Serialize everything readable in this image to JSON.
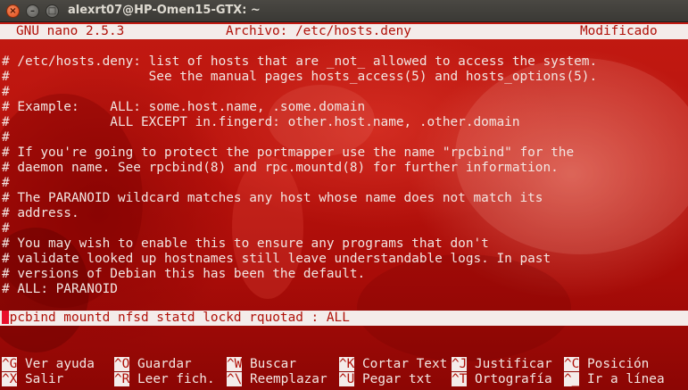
{
  "window": {
    "title": "alexrt07@HP-Omen15-GTX: ~",
    "close_glyph": "×",
    "min_glyph": "–",
    "max_glyph": "□"
  },
  "nano": {
    "version": "GNU nano 2.5.3",
    "file": "Archivo: /etc/hosts.deny",
    "status": "Modificado"
  },
  "content": [
    "# /etc/hosts.deny: list of hosts that are _not_ allowed to access the system.",
    "#                  See the manual pages hosts_access(5) and hosts_options(5).",
    "#",
    "# Example:    ALL: some.host.name, .some.domain",
    "#             ALL EXCEPT in.fingerd: other.host.name, .other.domain",
    "#",
    "# If you're going to protect the portmapper use the name \"rpcbind\" for the",
    "# daemon name. See rpcbind(8) and rpc.mountd(8) for further information.",
    "#",
    "# The PARANOID wildcard matches any host whose name does not match its",
    "# address.",
    "#",
    "# You may wish to enable this to ensure any programs that don't",
    "# validate looked up hostnames still leave understandable logs. In past",
    "# versions of Debian this has been the default.",
    "# ALL: PARANOID"
  ],
  "edit_line": "rpcbind mountd nfsd statd lockd rquotad : ALL",
  "shortcuts": [
    {
      "key": "^G",
      "label": "Ver ayuda"
    },
    {
      "key": "^O",
      "label": "Guardar"
    },
    {
      "key": "^W",
      "label": "Buscar"
    },
    {
      "key": "^K",
      "label": "Cortar Text"
    },
    {
      "key": "^J",
      "label": "Justificar"
    },
    {
      "key": "^C",
      "label": "Posición"
    },
    {
      "key": "^X",
      "label": "Salir"
    },
    {
      "key": "^R",
      "label": "Leer fich."
    },
    {
      "key": "^\\",
      "label": "Reemplazar"
    },
    {
      "key": "^U",
      "label": "Pegar txt"
    },
    {
      "key": "^T",
      "label": "Ortografía"
    },
    {
      "key": "^_",
      "label": "Ir a línea"
    }
  ],
  "colors": {
    "terminal_bg": "#b8120c",
    "text": "#f2e6e2",
    "bar_bg": "#f4ecea",
    "bar_text": "#b01008",
    "cursor": "#e8102c"
  }
}
